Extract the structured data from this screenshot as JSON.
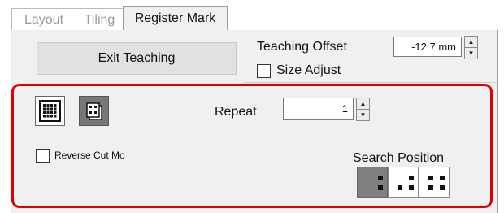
{
  "tabs": [
    {
      "label": "Layout",
      "active": false
    },
    {
      "label": "Tiling",
      "active": false
    },
    {
      "label": "Register Mark",
      "active": true
    }
  ],
  "exit_teaching": {
    "label": "Exit Teaching"
  },
  "teaching_offset": {
    "label": "Teaching Offset",
    "value": "-12.7 mm"
  },
  "size_adjust": {
    "label": "Size Adjust",
    "checked": false
  },
  "repeat": {
    "label": "Repeat",
    "value": "1"
  },
  "reverse_cut": {
    "label": "Reverse Cut Mo",
    "checked": false
  },
  "search_position": {
    "label": "Search Position",
    "options": [
      "right",
      "center",
      "both"
    ],
    "selected": "right"
  },
  "colors": {
    "highlight": "#e00000",
    "selected_button": "#808080"
  },
  "icons": {
    "grid_mode": "grid-icon",
    "single_mode": "single-mark-icon"
  }
}
